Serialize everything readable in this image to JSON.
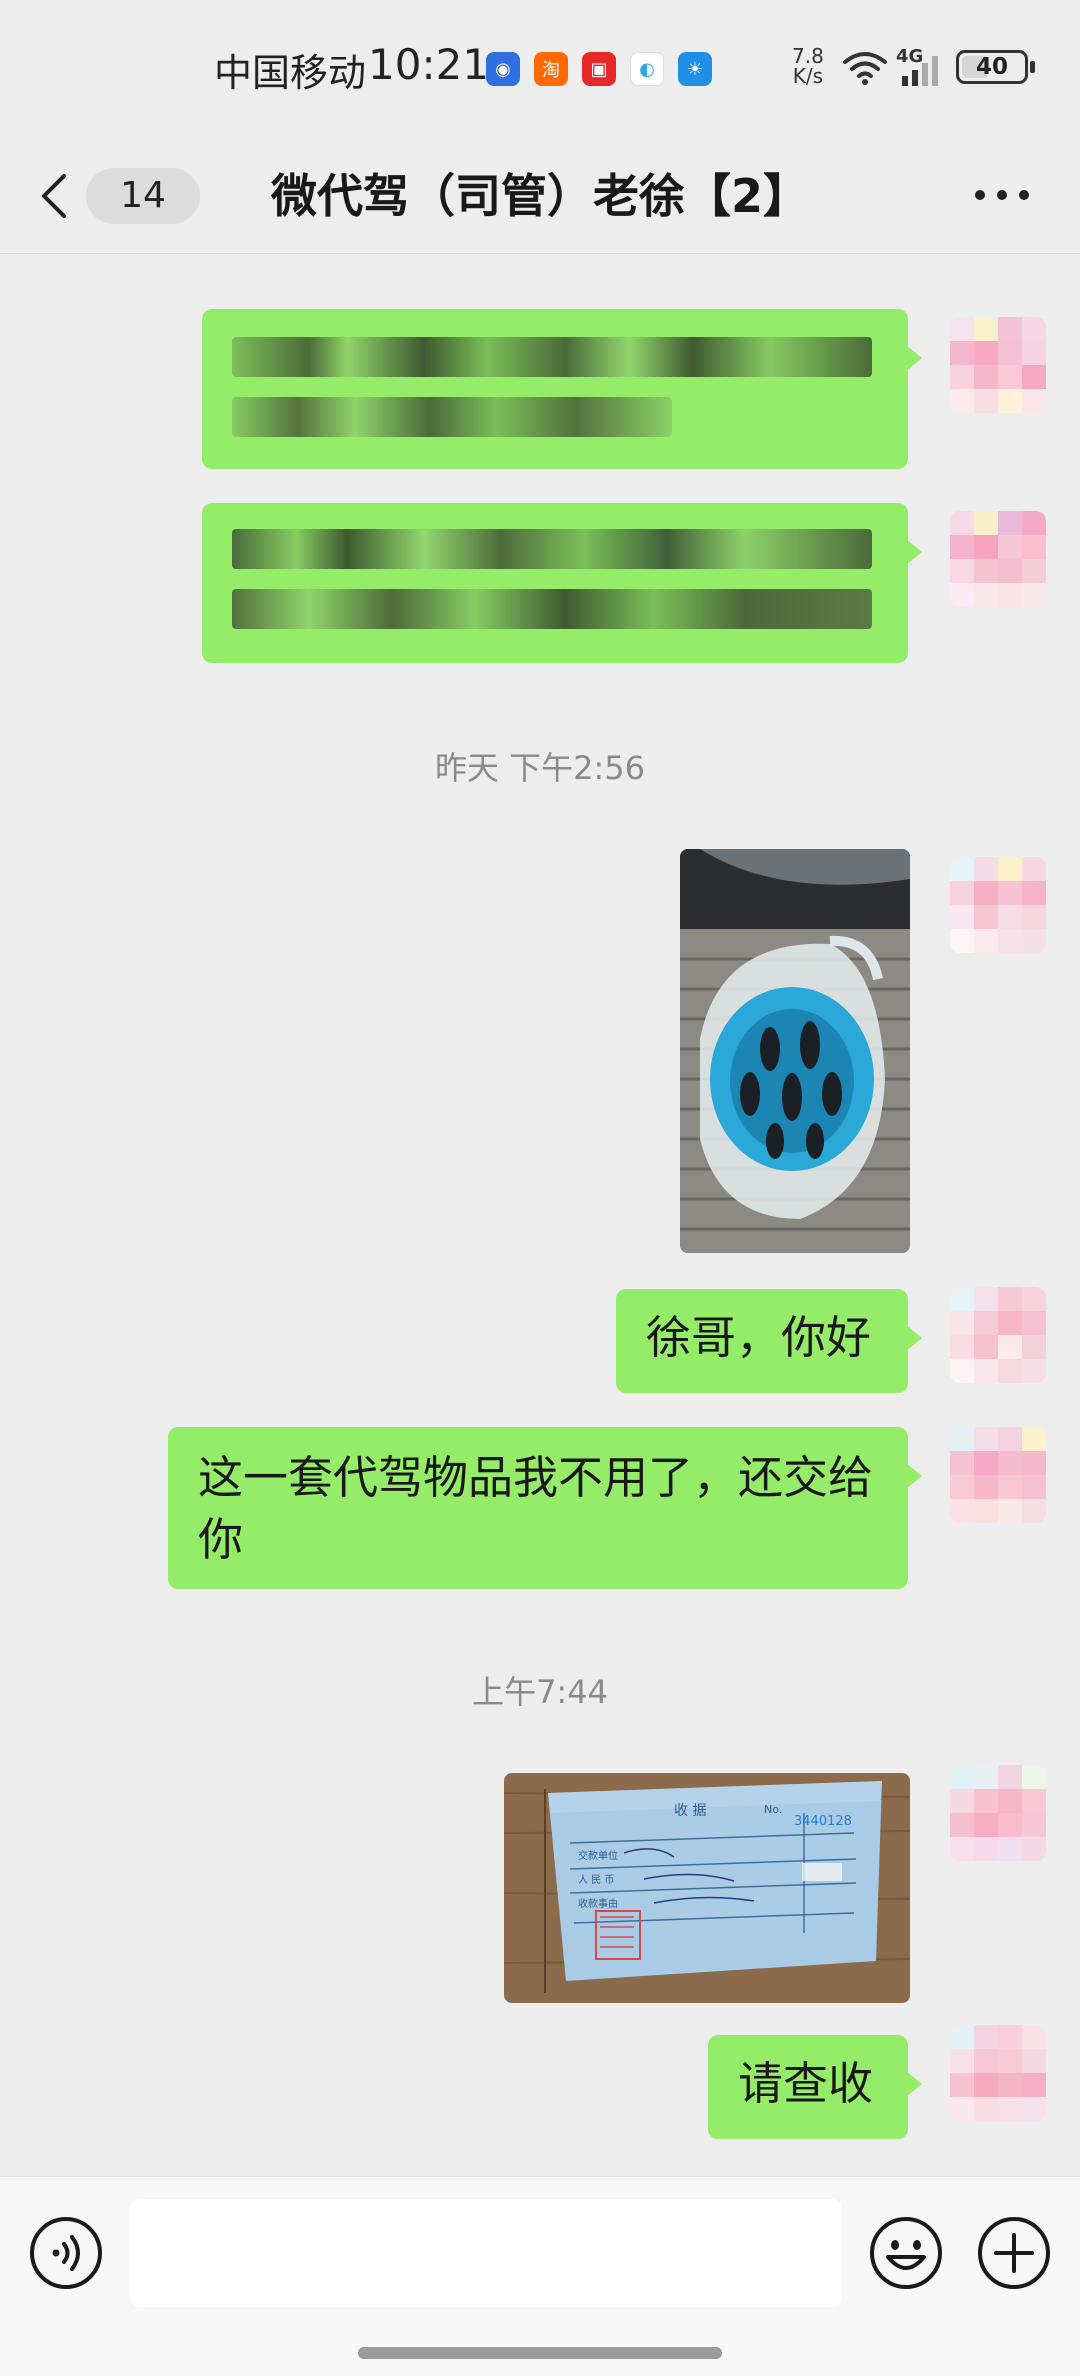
{
  "status_bar": {
    "carrier": "中国移动",
    "time": "10:21",
    "net_speed_value": "7.8",
    "net_speed_unit": "K/s",
    "network_type": "4G",
    "battery": "40",
    "battery_fraction": 0.4
  },
  "header": {
    "unread_count": "14",
    "title": "微代驾（司管）老徐【2】"
  },
  "messages": {
    "timestamp_1": "昨天 下午2:56",
    "text_1": "徐哥，你好",
    "text_2": "这一套代驾物品我不用了，还交给你",
    "timestamp_2": "上午7:44",
    "text_3": "请查收"
  },
  "colors": {
    "bubble": "#95ec69",
    "background": "#ededed"
  },
  "input_bar": {
    "voice_icon": "voice-icon",
    "emoji_icon": "emoji-icon",
    "plus_icon": "plus-icon"
  }
}
